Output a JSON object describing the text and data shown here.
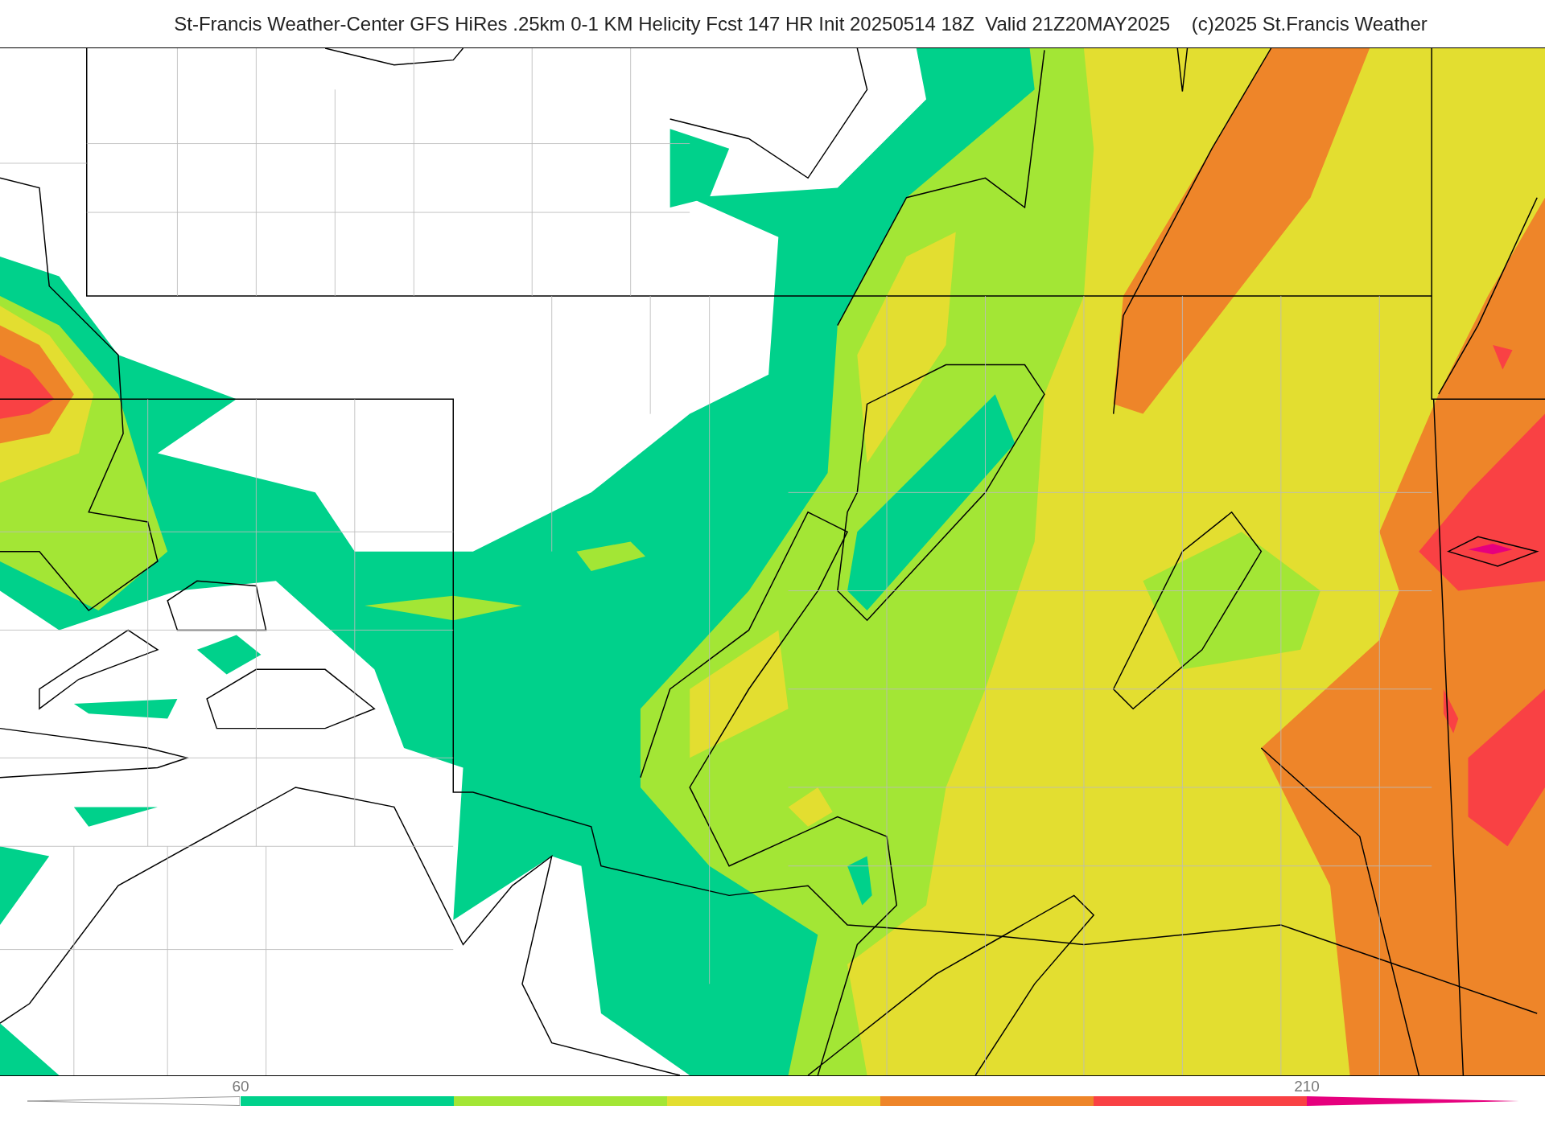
{
  "title": "St-Francis Weather-Center GFS HiRes .25km 0-1 KM Helicity Fcst 147 HR Init 20250514 18Z  Valid 21Z20MAY2025    (c)2025 St.Francis Weather",
  "colorbar": {
    "segments": [
      {
        "kind": "under"
      },
      {
        "kind": "bar",
        "color": "#00d18b",
        "start_label": "60"
      },
      {
        "kind": "bar",
        "color": "#a3e635"
      },
      {
        "kind": "bar",
        "color": "#e3de30"
      },
      {
        "kind": "bar",
        "color": "#ee8529"
      },
      {
        "kind": "bar",
        "color": "#f94144"
      },
      {
        "kind": "over",
        "color": "#e6007e",
        "start_label": "210"
      }
    ]
  }
}
